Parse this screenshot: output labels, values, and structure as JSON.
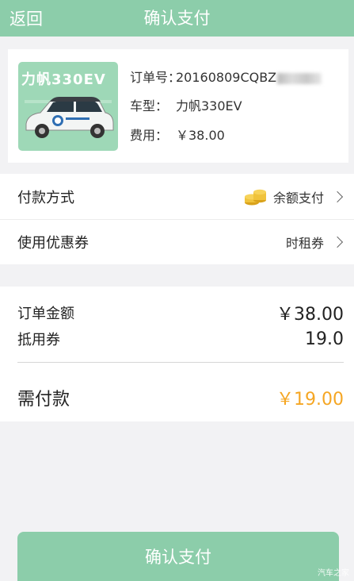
{
  "nav": {
    "back_label": "返回",
    "title": "确认支付"
  },
  "order": {
    "car_thumb_name": "力帆330EV",
    "order_no_label": "订单号：",
    "order_no_value": "20160809CQBZ",
    "model_label": "车型：",
    "model_value": "力帆330EV",
    "fee_label": "费用：",
    "fee_value": "￥38.00"
  },
  "payment": {
    "method_label": "付款方式",
    "method_value": "余额支付",
    "method_icon": "coin-stack-icon",
    "coupon_label": "使用优惠券",
    "coupon_value": "时租券"
  },
  "summary": {
    "order_amount_label": "订单金额",
    "order_amount_value": "￥38.00",
    "coupon_label": "抵用券",
    "coupon_value": "19.0",
    "payable_label": "需付款",
    "payable_value": "￥19.00"
  },
  "colors": {
    "brand": "#8ccdaa",
    "accent": "#f5a623"
  },
  "confirm_button": "确认支付",
  "watermark": "汽车之家"
}
